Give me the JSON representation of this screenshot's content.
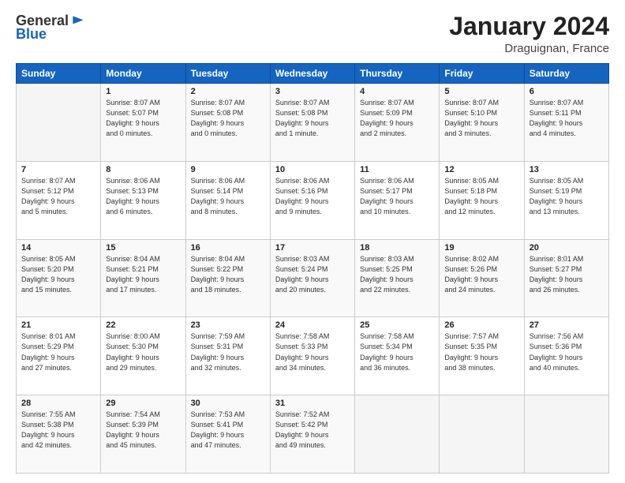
{
  "header": {
    "logo_general": "General",
    "logo_blue": "Blue",
    "month_title": "January 2024",
    "location": "Draguignan, France"
  },
  "columns": [
    "Sunday",
    "Monday",
    "Tuesday",
    "Wednesday",
    "Thursday",
    "Friday",
    "Saturday"
  ],
  "weeks": [
    [
      {
        "day": "",
        "info": ""
      },
      {
        "day": "1",
        "info": "Sunrise: 8:07 AM\nSunset: 5:07 PM\nDaylight: 9 hours\nand 0 minutes."
      },
      {
        "day": "2",
        "info": "Sunrise: 8:07 AM\nSunset: 5:08 PM\nDaylight: 9 hours\nand 0 minutes."
      },
      {
        "day": "3",
        "info": "Sunrise: 8:07 AM\nSunset: 5:08 PM\nDaylight: 9 hours\nand 1 minute."
      },
      {
        "day": "4",
        "info": "Sunrise: 8:07 AM\nSunset: 5:09 PM\nDaylight: 9 hours\nand 2 minutes."
      },
      {
        "day": "5",
        "info": "Sunrise: 8:07 AM\nSunset: 5:10 PM\nDaylight: 9 hours\nand 3 minutes."
      },
      {
        "day": "6",
        "info": "Sunrise: 8:07 AM\nSunset: 5:11 PM\nDaylight: 9 hours\nand 4 minutes."
      }
    ],
    [
      {
        "day": "7",
        "info": "Sunrise: 8:07 AM\nSunset: 5:12 PM\nDaylight: 9 hours\nand 5 minutes."
      },
      {
        "day": "8",
        "info": "Sunrise: 8:06 AM\nSunset: 5:13 PM\nDaylight: 9 hours\nand 6 minutes."
      },
      {
        "day": "9",
        "info": "Sunrise: 8:06 AM\nSunset: 5:14 PM\nDaylight: 9 hours\nand 8 minutes."
      },
      {
        "day": "10",
        "info": "Sunrise: 8:06 AM\nSunset: 5:16 PM\nDaylight: 9 hours\nand 9 minutes."
      },
      {
        "day": "11",
        "info": "Sunrise: 8:06 AM\nSunset: 5:17 PM\nDaylight: 9 hours\nand 10 minutes."
      },
      {
        "day": "12",
        "info": "Sunrise: 8:05 AM\nSunset: 5:18 PM\nDaylight: 9 hours\nand 12 minutes."
      },
      {
        "day": "13",
        "info": "Sunrise: 8:05 AM\nSunset: 5:19 PM\nDaylight: 9 hours\nand 13 minutes."
      }
    ],
    [
      {
        "day": "14",
        "info": "Sunrise: 8:05 AM\nSunset: 5:20 PM\nDaylight: 9 hours\nand 15 minutes."
      },
      {
        "day": "15",
        "info": "Sunrise: 8:04 AM\nSunset: 5:21 PM\nDaylight: 9 hours\nand 17 minutes."
      },
      {
        "day": "16",
        "info": "Sunrise: 8:04 AM\nSunset: 5:22 PM\nDaylight: 9 hours\nand 18 minutes."
      },
      {
        "day": "17",
        "info": "Sunrise: 8:03 AM\nSunset: 5:24 PM\nDaylight: 9 hours\nand 20 minutes."
      },
      {
        "day": "18",
        "info": "Sunrise: 8:03 AM\nSunset: 5:25 PM\nDaylight: 9 hours\nand 22 minutes."
      },
      {
        "day": "19",
        "info": "Sunrise: 8:02 AM\nSunset: 5:26 PM\nDaylight: 9 hours\nand 24 minutes."
      },
      {
        "day": "20",
        "info": "Sunrise: 8:01 AM\nSunset: 5:27 PM\nDaylight: 9 hours\nand 26 minutes."
      }
    ],
    [
      {
        "day": "21",
        "info": "Sunrise: 8:01 AM\nSunset: 5:29 PM\nDaylight: 9 hours\nand 27 minutes."
      },
      {
        "day": "22",
        "info": "Sunrise: 8:00 AM\nSunset: 5:30 PM\nDaylight: 9 hours\nand 29 minutes."
      },
      {
        "day": "23",
        "info": "Sunrise: 7:59 AM\nSunset: 5:31 PM\nDaylight: 9 hours\nand 32 minutes."
      },
      {
        "day": "24",
        "info": "Sunrise: 7:58 AM\nSunset: 5:33 PM\nDaylight: 9 hours\nand 34 minutes."
      },
      {
        "day": "25",
        "info": "Sunrise: 7:58 AM\nSunset: 5:34 PM\nDaylight: 9 hours\nand 36 minutes."
      },
      {
        "day": "26",
        "info": "Sunrise: 7:57 AM\nSunset: 5:35 PM\nDaylight: 9 hours\nand 38 minutes."
      },
      {
        "day": "27",
        "info": "Sunrise: 7:56 AM\nSunset: 5:36 PM\nDaylight: 9 hours\nand 40 minutes."
      }
    ],
    [
      {
        "day": "28",
        "info": "Sunrise: 7:55 AM\nSunset: 5:38 PM\nDaylight: 9 hours\nand 42 minutes."
      },
      {
        "day": "29",
        "info": "Sunrise: 7:54 AM\nSunset: 5:39 PM\nDaylight: 9 hours\nand 45 minutes."
      },
      {
        "day": "30",
        "info": "Sunrise: 7:53 AM\nSunset: 5:41 PM\nDaylight: 9 hours\nand 47 minutes."
      },
      {
        "day": "31",
        "info": "Sunrise: 7:52 AM\nSunset: 5:42 PM\nDaylight: 9 hours\nand 49 minutes."
      },
      {
        "day": "",
        "info": ""
      },
      {
        "day": "",
        "info": ""
      },
      {
        "day": "",
        "info": ""
      }
    ]
  ]
}
